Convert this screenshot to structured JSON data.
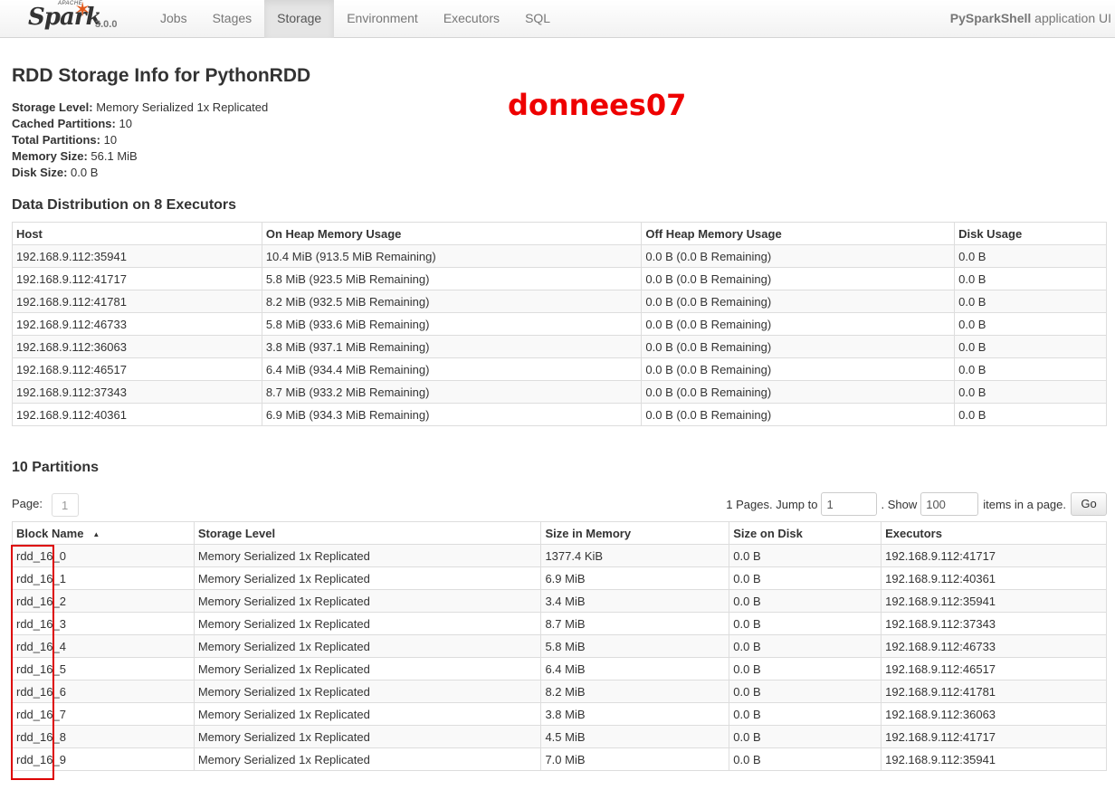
{
  "navbar": {
    "brand_apache": "APACHE",
    "brand_name": "Spark",
    "version": "3.0.0",
    "tabs": [
      {
        "label": "Jobs",
        "active": false
      },
      {
        "label": "Stages",
        "active": false
      },
      {
        "label": "Storage",
        "active": true
      },
      {
        "label": "Environment",
        "active": false
      },
      {
        "label": "Executors",
        "active": false
      },
      {
        "label": "SQL",
        "active": false
      }
    ],
    "app_name": "PySparkShell",
    "app_suffix": " application UI"
  },
  "page_title": "RDD Storage Info for PythonRDD",
  "watermark": "donnees07",
  "summary": {
    "storage_level_label": "Storage Level:",
    "storage_level_value": " Memory Serialized 1x Replicated",
    "cached_partitions_label": "Cached Partitions:",
    "cached_partitions_value": " 10",
    "total_partitions_label": "Total Partitions:",
    "total_partitions_value": " 10",
    "memory_size_label": "Memory Size:",
    "memory_size_value": " 56.1 MiB",
    "disk_size_label": "Disk Size:",
    "disk_size_value": " 0.0 B"
  },
  "distribution": {
    "title": "Data Distribution on 8 Executors",
    "headers": [
      "Host",
      "On Heap Memory Usage",
      "Off Heap Memory Usage",
      "Disk Usage"
    ],
    "rows": [
      [
        "192.168.9.112:35941",
        "10.4 MiB (913.5 MiB Remaining)",
        "0.0 B (0.0 B Remaining)",
        "0.0 B"
      ],
      [
        "192.168.9.112:41717",
        "5.8 MiB (923.5 MiB Remaining)",
        "0.0 B (0.0 B Remaining)",
        "0.0 B"
      ],
      [
        "192.168.9.112:41781",
        "8.2 MiB (932.5 MiB Remaining)",
        "0.0 B (0.0 B Remaining)",
        "0.0 B"
      ],
      [
        "192.168.9.112:46733",
        "5.8 MiB (933.6 MiB Remaining)",
        "0.0 B (0.0 B Remaining)",
        "0.0 B"
      ],
      [
        "192.168.9.112:36063",
        "3.8 MiB (937.1 MiB Remaining)",
        "0.0 B (0.0 B Remaining)",
        "0.0 B"
      ],
      [
        "192.168.9.112:46517",
        "6.4 MiB (934.4 MiB Remaining)",
        "0.0 B (0.0 B Remaining)",
        "0.0 B"
      ],
      [
        "192.168.9.112:37343",
        "8.7 MiB (933.2 MiB Remaining)",
        "0.0 B (0.0 B Remaining)",
        "0.0 B"
      ],
      [
        "192.168.9.112:40361",
        "6.9 MiB (934.3 MiB Remaining)",
        "0.0 B (0.0 B Remaining)",
        "0.0 B"
      ]
    ]
  },
  "partitions": {
    "title": "10 Partitions",
    "page_label": "Page:",
    "current_page": "1",
    "pages_text": "1 Pages. Jump to",
    "jump_value": "1",
    "show_text": ". Show",
    "show_value": "100",
    "items_text": "items in a page.",
    "go_label": "Go",
    "sort_icon": "▲",
    "headers": [
      "Block Name",
      "Storage Level",
      "Size in Memory",
      "Size on Disk",
      "Executors"
    ],
    "rows": [
      [
        "rdd_16_0",
        "Memory Serialized 1x Replicated",
        "1377.4 KiB",
        "0.0 B",
        "192.168.9.112:41717"
      ],
      [
        "rdd_16_1",
        "Memory Serialized 1x Replicated",
        "6.9 MiB",
        "0.0 B",
        "192.168.9.112:40361"
      ],
      [
        "rdd_16_2",
        "Memory Serialized 1x Replicated",
        "3.4 MiB",
        "0.0 B",
        "192.168.9.112:35941"
      ],
      [
        "rdd_16_3",
        "Memory Serialized 1x Replicated",
        "8.7 MiB",
        "0.0 B",
        "192.168.9.112:37343"
      ],
      [
        "rdd_16_4",
        "Memory Serialized 1x Replicated",
        "5.8 MiB",
        "0.0 B",
        "192.168.9.112:46733"
      ],
      [
        "rdd_16_5",
        "Memory Serialized 1x Replicated",
        "6.4 MiB",
        "0.0 B",
        "192.168.9.112:46517"
      ],
      [
        "rdd_16_6",
        "Memory Serialized 1x Replicated",
        "8.2 MiB",
        "0.0 B",
        "192.168.9.112:41781"
      ],
      [
        "rdd_16_7",
        "Memory Serialized 1x Replicated",
        "3.8 MiB",
        "0.0 B",
        "192.168.9.112:36063"
      ],
      [
        "rdd_16_8",
        "Memory Serialized 1x Replicated",
        "4.5 MiB",
        "0.0 B",
        "192.168.9.112:41717"
      ],
      [
        "rdd_16_9",
        "Memory Serialized 1x Replicated",
        "7.0 MiB",
        "0.0 B",
        "192.168.9.112:35941"
      ]
    ]
  }
}
